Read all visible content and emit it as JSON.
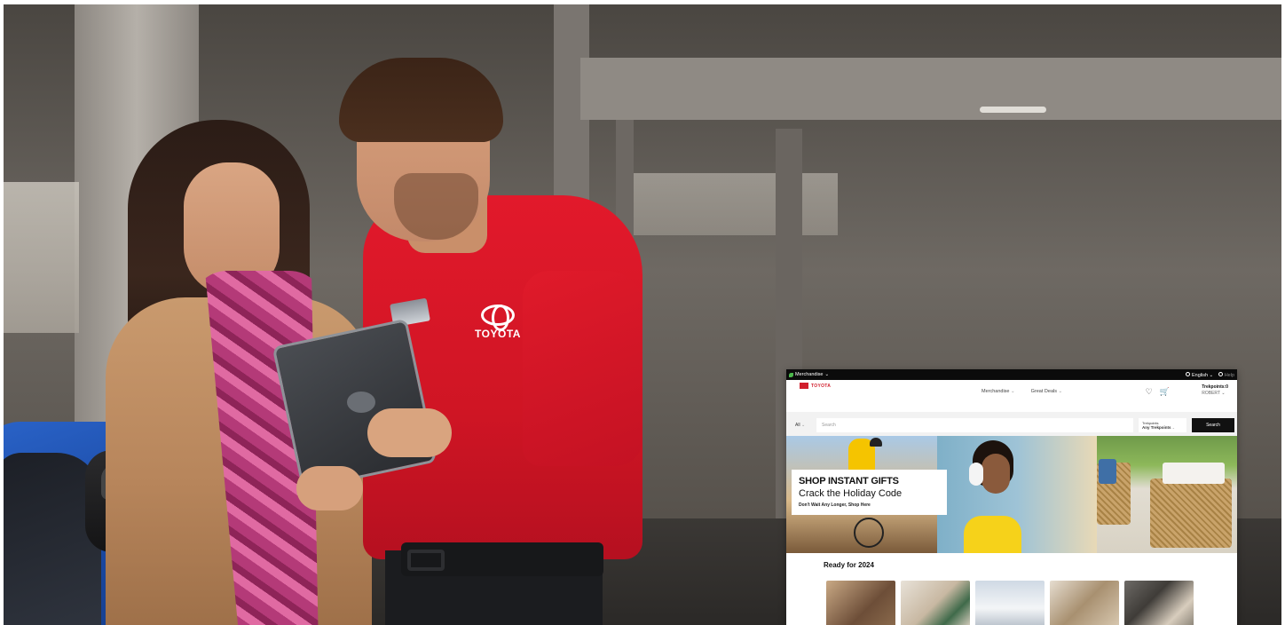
{
  "hero": {
    "shirt_logo_text": "TOYOTA"
  },
  "site": {
    "topbar": {
      "category_label": "Merchandise",
      "language_label": "English",
      "help_label": "Help"
    },
    "header": {
      "brand": "TOYOTA",
      "nav": [
        {
          "label": "Merchandise"
        },
        {
          "label": "Great Deals"
        }
      ],
      "trekpoints_label": "Trekpoints:0",
      "user_name": "ROBERT"
    },
    "search": {
      "category": "All",
      "placeholder": "Search",
      "points_filter_caption": "Trekpoints",
      "points_filter_value": "Any Trekpoints",
      "button_label": "Search"
    },
    "promo": {
      "headline": "SHOP INSTANT GIFTS",
      "subheadline": "Crack the Holiday Code",
      "cta": "Don't Wait Any Longer, Shop Here"
    },
    "section_title": "Ready for 2024",
    "icons": {
      "wishlist": "heart-icon",
      "cart": "cart-icon",
      "globe": "globe-icon",
      "help": "help-circle-icon",
      "chevron": "chevron-down-icon"
    },
    "colors": {
      "brand_red": "#d11f2d",
      "search_button": "#111111"
    }
  }
}
